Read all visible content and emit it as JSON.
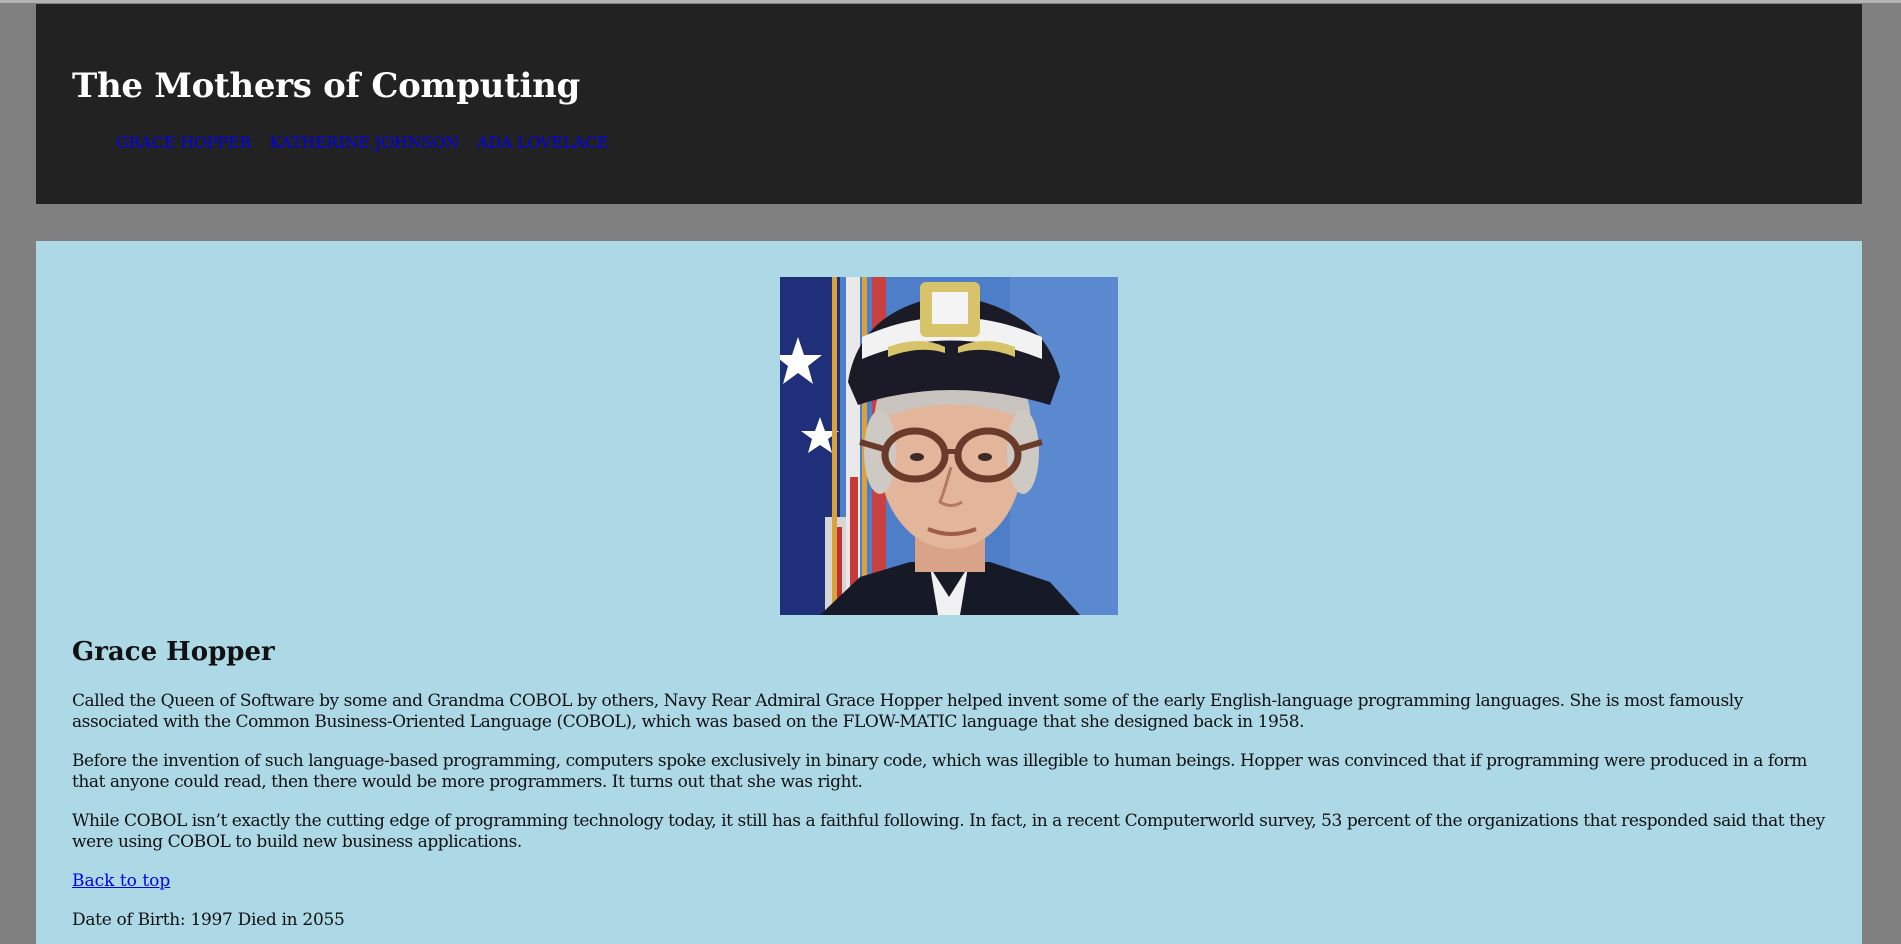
{
  "header": {
    "title": "The Mothers of Computing",
    "nav": [
      {
        "label": "GRACE HOPPER"
      },
      {
        "label": "KATHERINE JOHNSON"
      },
      {
        "label": "ADA LOVELACE"
      }
    ]
  },
  "profile": {
    "name": "Grace Hopper",
    "paragraphs": [
      "Called the Queen of Software by some and Grandma COBOL by others, Navy Rear Admiral Grace Hopper helped invent some of the early English-language programming languages. She is most famously associated with the Common Business-Oriented Language (COBOL), which was based on the FLOW-MATIC language that she designed back in 1958.",
      "Before the invention of such language-based programming, computers spoke exclusively in binary code, which was illegible to human beings. Hopper was convinced that if programming were produced in a form that anyone could read, then there would be more programmers. It turns out that she was right.",
      "While COBOL isn’t exactly the cutting edge of programming technology today, it still has a faithful following. In fact, in a recent Computerworld survey, 53 percent of the organizations that responded said that they were using COBOL to build new business applications."
    ],
    "back_to_top": "Back to top",
    "dates": "Date of Birth: 1997 Died in 2055"
  },
  "colors": {
    "page_bg": "#808080",
    "header_bg": "#222222",
    "content_bg": "#add8e6",
    "link": "#0000ee"
  }
}
